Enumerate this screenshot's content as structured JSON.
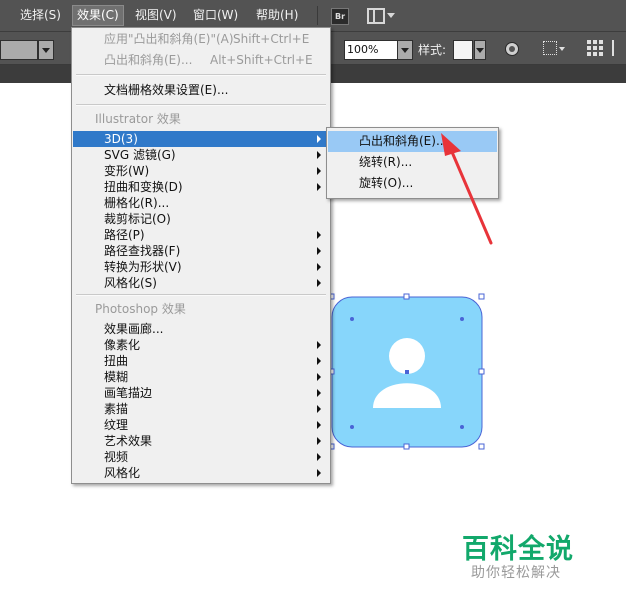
{
  "menubar": {
    "items": [
      {
        "label": "选择(S)"
      },
      {
        "label": "效果(C)",
        "active": true
      },
      {
        "label": "视图(V)"
      },
      {
        "label": "窗口(W)"
      },
      {
        "label": "帮助(H)"
      }
    ],
    "br_label": "Br"
  },
  "controlbar": {
    "opacity_value": "100%",
    "style_label": "样式:"
  },
  "effect_menu": {
    "apply_last": {
      "label": "应用\"凸出和斜角(E)\"(A)",
      "shortcut": "Shift+Ctrl+E"
    },
    "last_effect": {
      "label": "凸出和斜角(E)...",
      "shortcut": "Alt+Shift+Ctrl+E"
    },
    "doc_raster_settings": "文档栅格效果设置(E)...",
    "illustrator_section": "Illustrator 效果",
    "illustrator_items": [
      {
        "label": "3D(3)",
        "submenu": true,
        "highlighted": true
      },
      {
        "label": "SVG 滤镜(G)",
        "submenu": true
      },
      {
        "label": "变形(W)",
        "submenu": true
      },
      {
        "label": "扭曲和变换(D)",
        "submenu": true
      },
      {
        "label": "栅格化(R)...",
        "submenu": false
      },
      {
        "label": "裁剪标记(O)",
        "submenu": false
      },
      {
        "label": "路径(P)",
        "submenu": true
      },
      {
        "label": "路径查找器(F)",
        "submenu": true
      },
      {
        "label": "转换为形状(V)",
        "submenu": true
      },
      {
        "label": "风格化(S)",
        "submenu": true
      }
    ],
    "photoshop_section": "Photoshop 效果",
    "photoshop_items": [
      {
        "label": "效果画廊...",
        "submenu": false
      },
      {
        "label": "像素化",
        "submenu": true
      },
      {
        "label": "扭曲",
        "submenu": true
      },
      {
        "label": "模糊",
        "submenu": true
      },
      {
        "label": "画笔描边",
        "submenu": true
      },
      {
        "label": "素描",
        "submenu": true
      },
      {
        "label": "纹理",
        "submenu": true
      },
      {
        "label": "艺术效果",
        "submenu": true
      },
      {
        "label": "视频",
        "submenu": true
      },
      {
        "label": "风格化",
        "submenu": true
      }
    ]
  },
  "submenu_3d": {
    "items": [
      {
        "label": "凸出和斜角(E)...",
        "highlighted": true
      },
      {
        "label": "绕转(R)..."
      },
      {
        "label": "旋转(O)..."
      }
    ]
  },
  "artwork": {
    "fill_color": "#87d6fb",
    "icon": "user-icon"
  },
  "annotation": {
    "color": "#e8343a"
  },
  "watermark": {
    "title": "百科全说",
    "subtitle": "助你轻松解决",
    "color": "#12a86b"
  },
  "colors": {
    "chrome": "#535353",
    "menu_bg": "#f0f0f0",
    "menu_highlight": "#3079c9",
    "submenu_highlight": "#99c9f5"
  }
}
